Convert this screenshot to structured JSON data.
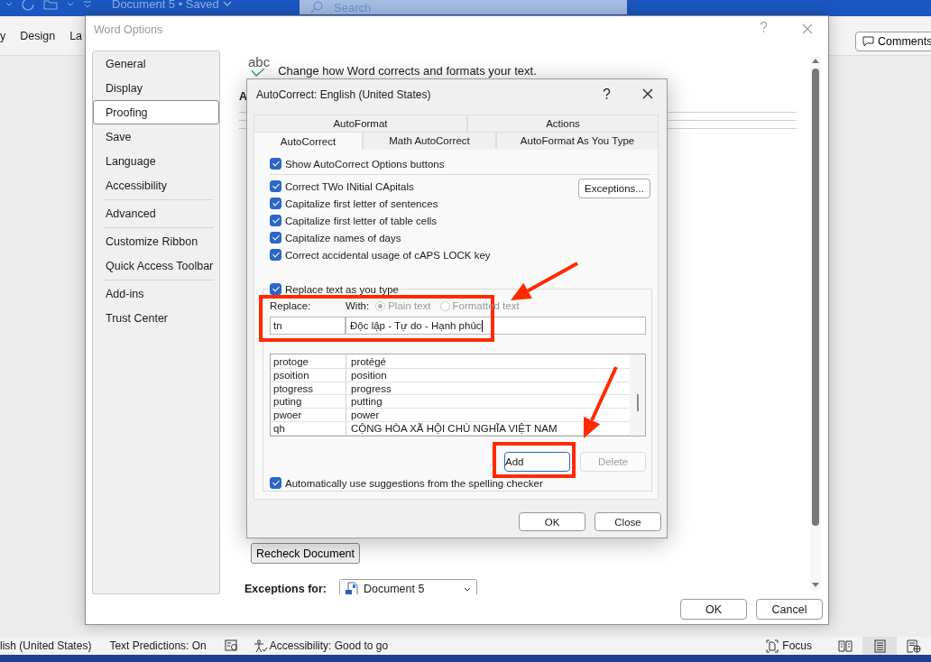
{
  "word_window": {
    "document_title": "Document 5 • Saved",
    "search": {
      "placeholder": "Search"
    },
    "ribbon_tabs": [
      {
        "label": "y"
      },
      {
        "label": "Design"
      },
      {
        "label": "La"
      }
    ],
    "comments_button": "Comments",
    "status_bar": {
      "language": "lish (United States)",
      "text_predictions": "Text Predictions: On",
      "accessibility": "Accessibility: Good to go",
      "focus": "Focus",
      "views": [
        {
          "kind": "read",
          "selected": false
        },
        {
          "kind": "print",
          "selected": true
        },
        {
          "kind": "web",
          "selected": false
        }
      ]
    }
  },
  "word_options": {
    "title": "Word Options",
    "sidebar_groups": [
      {
        "items": [
          {
            "label": "General",
            "selected": false
          },
          {
            "label": "Display",
            "selected": false
          },
          {
            "label": "Proofing",
            "selected": true
          },
          {
            "label": "Save",
            "selected": false
          },
          {
            "label": "Language",
            "selected": false
          },
          {
            "label": "Accessibility",
            "selected": false
          }
        ]
      },
      {
        "items": [
          {
            "label": "Advanced",
            "selected": false
          }
        ]
      },
      {
        "items": [
          {
            "label": "Customize Ribbon",
            "selected": false
          },
          {
            "label": "Quick Access Toolbar",
            "selected": false
          }
        ]
      },
      {
        "items": [
          {
            "label": "Add-ins",
            "selected": false
          },
          {
            "label": "Trust Center",
            "selected": false
          }
        ]
      }
    ],
    "section_heading": "A",
    "header_icon_text": "abc",
    "header": "Change how Word corrects and formats your text.",
    "recheck_button": "Recheck Document",
    "exceptions_label": "Exceptions for:",
    "exceptions_value": "Document 5",
    "buttons": [
      "OK",
      "Cancel"
    ]
  },
  "autocorrect_dialog": {
    "title": "AutoCorrect: English (United States)",
    "tab_rows": [
      [
        {
          "label": "AutoFormat",
          "selected": false
        },
        {
          "label": "Actions",
          "selected": false
        }
      ],
      [
        {
          "label": "AutoCorrect",
          "selected": true
        },
        {
          "label": "Math AutoCorrect",
          "selected": false
        },
        {
          "label": "AutoFormat As You Type",
          "selected": false
        }
      ]
    ],
    "show_options": {
      "label": "Show AutoCorrect Options buttons",
      "checked": true
    },
    "options": [
      {
        "label": "Correct TWo INitial CApitals",
        "checked": true
      },
      {
        "label": "Capitalize first letter of sentences",
        "checked": true
      },
      {
        "label": "Capitalize first letter of table cells",
        "checked": true
      },
      {
        "label": "Capitalize names of days",
        "checked": true
      },
      {
        "label": "Correct accidental usage of cAPS LOCK key",
        "checked": true
      }
    ],
    "exceptions_button": "Exceptions...",
    "replace_as_you_type": {
      "label": "Replace text as you type",
      "checked": true
    },
    "replace_label": "Replace:",
    "with_label": "With:",
    "format_options": [
      {
        "label": "Plain text",
        "selected": true,
        "disabled": true
      },
      {
        "label": "Formatted text",
        "selected": false,
        "disabled": true
      }
    ],
    "replace_value": "tn",
    "with_value": "Độc lập - Tự do - Hạnh phúc",
    "entries": [
      {
        "replace": "protoge",
        "with": "protégé"
      },
      {
        "replace": "psoition",
        "with": "position"
      },
      {
        "replace": "ptogress",
        "with": "progress"
      },
      {
        "replace": "puting",
        "with": "putting"
      },
      {
        "replace": "pwoer",
        "with": "power"
      },
      {
        "replace": "qh",
        "with": "CỘNG HÒA XÃ HỘI CHỦ NGHĨA VIỆT NAM"
      }
    ],
    "add_button": {
      "label": "Add",
      "disabled": false
    },
    "delete_button": {
      "label": "Delete",
      "disabled": true
    },
    "spelling_suggestions": {
      "label": "Automatically use suggestions from the spelling checker",
      "checked": true
    },
    "buttons": [
      "OK",
      "Close"
    ]
  }
}
